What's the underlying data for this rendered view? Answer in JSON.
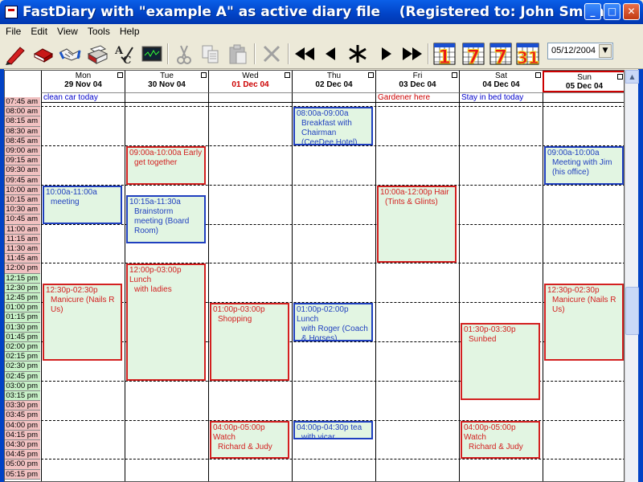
{
  "window": {
    "title": "FastDiary with \"example A\" as active diary file    (Registered to: John Smith)"
  },
  "menu": [
    "File",
    "Edit",
    "View",
    "Tools",
    "Help"
  ],
  "toolbar": {
    "buttons": [
      "pencil-icon",
      "book-icon",
      "handshake-icon",
      "printer-icon",
      "spellcheck-icon",
      "monitor-icon",
      "cut-icon",
      "copy-icon",
      "paste-icon",
      "delete-icon",
      "rewind-icon",
      "back-icon",
      "today-star-icon",
      "forward-icon",
      "fast-forward-icon",
      "view-1-day-icon",
      "view-7-day-icon",
      "view-7-day-alt-icon",
      "view-31-day-icon"
    ],
    "view_numbers": [
      "1",
      "7",
      "7",
      "31"
    ],
    "date": "05/12/2004"
  },
  "days": [
    {
      "name": "Mon",
      "date": "29 Nov 04",
      "note": "clean car today",
      "note_color": "#0000cc"
    },
    {
      "name": "Tue",
      "date": "30 Nov 04",
      "note": "",
      "note_color": "#0000cc"
    },
    {
      "name": "Wed",
      "date": "01 Dec 04",
      "note": "",
      "note_color": "#0000cc",
      "today": true
    },
    {
      "name": "Thu",
      "date": "02 Dec 04",
      "note": "",
      "note_color": "#0000cc"
    },
    {
      "name": "Fri",
      "date": "03 Dec 04",
      "note": "Gardener here",
      "note_color": "#cc0000"
    },
    {
      "name": "Sat",
      "date": "04 Dec 04",
      "note": "Stay in bed today",
      "note_color": "#0000cc"
    },
    {
      "name": "Sun",
      "date": "05 Dec 04",
      "note": "",
      "note_color": "#0000cc",
      "selected": true
    }
  ],
  "times": [
    "07:45 am",
    "08:00 am",
    "08:15 am",
    "08:30 am",
    "08:45 am",
    "09:00 am",
    "09:15 am",
    "09:30 am",
    "09:45 am",
    "10:00 am",
    "10:15 am",
    "10:30 am",
    "10:45 am",
    "11:00 am",
    "11:15 am",
    "11:30 am",
    "11:45 am",
    "12:00 pm",
    "12:15 pm",
    "12:30 pm",
    "12:45 pm",
    "01:00 pm",
    "01:15 pm",
    "01:30 pm",
    "01:45 pm",
    "02:00 pm",
    "02:15 pm",
    "02:30 pm",
    "02:45 pm",
    "03:00 pm",
    "03:15 pm",
    "03:30 pm",
    "03:45 pm",
    "04:00 pm",
    "04:15 pm",
    "04:30 pm",
    "04:45 pm",
    "05:00 pm",
    "05:15 pm"
  ],
  "appointments": [
    {
      "day": 0,
      "start": "10:00",
      "end": "11:00",
      "time": "10:00a-11:00a",
      "desc": "meeting",
      "color": "blue"
    },
    {
      "day": 0,
      "start": "12:30",
      "end": "14:30",
      "time": "12:30p-02:30p",
      "desc": "Manicure (Nails R Us)",
      "color": "red"
    },
    {
      "day": 1,
      "start": "09:00",
      "end": "10:00",
      "time": "09:00a-10:00a Early",
      "desc": "get together",
      "color": "red"
    },
    {
      "day": 1,
      "start": "10:15",
      "end": "11:30",
      "time": "10:15a-11:30a",
      "desc": "Brainstorm meeting (Board Room)",
      "color": "blue"
    },
    {
      "day": 1,
      "start": "12:00",
      "end": "15:00",
      "time": "12:00p-03:00p Lunch",
      "desc": "with ladies",
      "color": "red"
    },
    {
      "day": 2,
      "start": "13:00",
      "end": "15:00",
      "time": "01:00p-03:00p",
      "desc": "Shopping",
      "color": "red"
    },
    {
      "day": 2,
      "start": "16:00",
      "end": "17:00",
      "time": "04:00p-05:00p Watch",
      "desc": "Richard & Judy",
      "color": "red"
    },
    {
      "day": 3,
      "start": "08:00",
      "end": "09:00",
      "time": "08:00a-09:00a",
      "desc": "Breakfast with Chairman (CeeDee Hotel)",
      "color": "blue"
    },
    {
      "day": 3,
      "start": "13:00",
      "end": "14:00",
      "time": "01:00p-02:00p Lunch",
      "desc": "with Roger (Coach & Horses)",
      "color": "blue"
    },
    {
      "day": 3,
      "start": "16:00",
      "end": "16:30",
      "time": "04:00p-04:30p tea",
      "desc": "with vicar",
      "color": "blue"
    },
    {
      "day": 4,
      "start": "10:00",
      "end": "12:00",
      "time": "10:00a-12:00p Hair",
      "desc": "(Tints & Glints)",
      "color": "red"
    },
    {
      "day": 5,
      "start": "13:30",
      "end": "15:30",
      "time": "01:30p-03:30p",
      "desc": "Sunbed",
      "color": "red"
    },
    {
      "day": 5,
      "start": "16:00",
      "end": "17:00",
      "time": "04:00p-05:00p Watch",
      "desc": "Richard & Judy",
      "color": "red"
    },
    {
      "day": 6,
      "start": "09:00",
      "end": "10:00",
      "time": "09:00a-10:00a",
      "desc": "Meeting with Jim (his office)",
      "color": "blue"
    },
    {
      "day": 6,
      "start": "12:30",
      "end": "14:30",
      "time": "12:30p-02:30p",
      "desc": "Manicure (Nails R Us)",
      "color": "red"
    }
  ]
}
